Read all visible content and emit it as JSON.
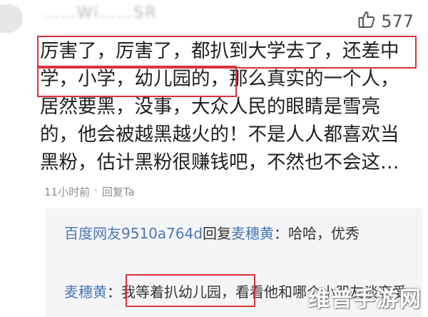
{
  "comment": {
    "username": "……Wi……SR",
    "like_count": "577",
    "lines": [
      "厉害了，厉害了，都扒到大学去了，还差中",
      "学，小学，幼儿园的，那么真实的一个人，",
      "居然要黑，没事，大众人民的眼睛是雪亮",
      "的，他会被越黑越火的！不是人人都喜欢当",
      "黑粉，估计黑粉很赚钱吧，不然也不会这…"
    ],
    "time": "11小时前",
    "reply_action": "回复Ta"
  },
  "replies": [
    {
      "author": "百度网友9510a764d",
      "verb": "回复",
      "target": "麦穗黄",
      "text": "：哈哈，优秀"
    },
    {
      "author": "麦穗黄",
      "text": "：我等着扒幼儿园，看看他和哪个小朋友谈恋爱"
    }
  ],
  "watermark": "维普手游网",
  "colors": {
    "highlight_box": "#d9323b",
    "link_blue": "#4b78b8",
    "panel_bg": "#f5f5f7"
  }
}
